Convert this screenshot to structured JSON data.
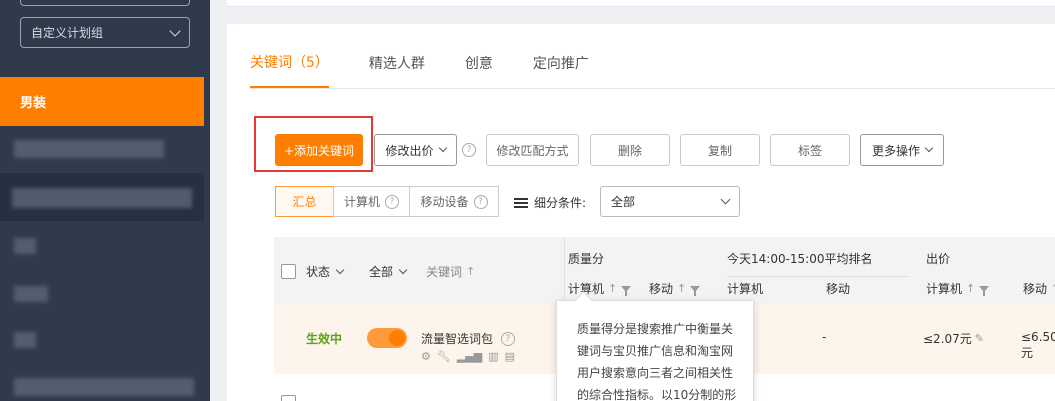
{
  "sidebar": {
    "plan_group_select": "自定义计划组",
    "active_item": "男装"
  },
  "tabs": [
    {
      "label": "关键词（5）",
      "active": true
    },
    {
      "label": "精选人群",
      "active": false
    },
    {
      "label": "创意",
      "active": false
    },
    {
      "label": "定向推广",
      "active": false
    }
  ],
  "toolbar": {
    "add_keyword": "+添加关键词",
    "modify_bid": "修改出价",
    "modify_match": "修改匹配方式",
    "delete": "删除",
    "copy": "复制",
    "tag": "标签",
    "more_actions": "更多操作"
  },
  "view_segments": {
    "summary": "汇总",
    "computer": "计算机",
    "mobile": "移动设备"
  },
  "filter": {
    "label": "细分条件:",
    "value": "全部"
  },
  "table": {
    "headers": {
      "status": "状态",
      "all": "全部",
      "keyword": "关键词",
      "quality_score": "质量分",
      "qs_computer": "计算机",
      "qs_mobile": "移动",
      "rank_group": "今天14:00-15:00平均排名",
      "rank_computer": "计算机",
      "rank_mobile": "移动",
      "bid": "出价",
      "bid_computer": "计算机",
      "bid_mobile": "移动"
    },
    "rows": [
      {
        "status": "生效中",
        "keyword": "流量智选词包",
        "rank_mobile": "-",
        "bid_computer": "≤2.07元",
        "bid_mobile": "≤6.50元"
      }
    ]
  },
  "tooltip": {
    "lines": [
      "质量得分是搜索推广中衡量关",
      "键词与宝贝推广信息和淘宝网",
      "用户搜索意向三者之间相关性",
      "的综合性指标。以10分制的形"
    ]
  },
  "colors": {
    "accent": "#ff7e00",
    "sidebar_bg": "#2f3a4b",
    "status_green": "#5aa315",
    "highlight_red": "#e53935"
  }
}
